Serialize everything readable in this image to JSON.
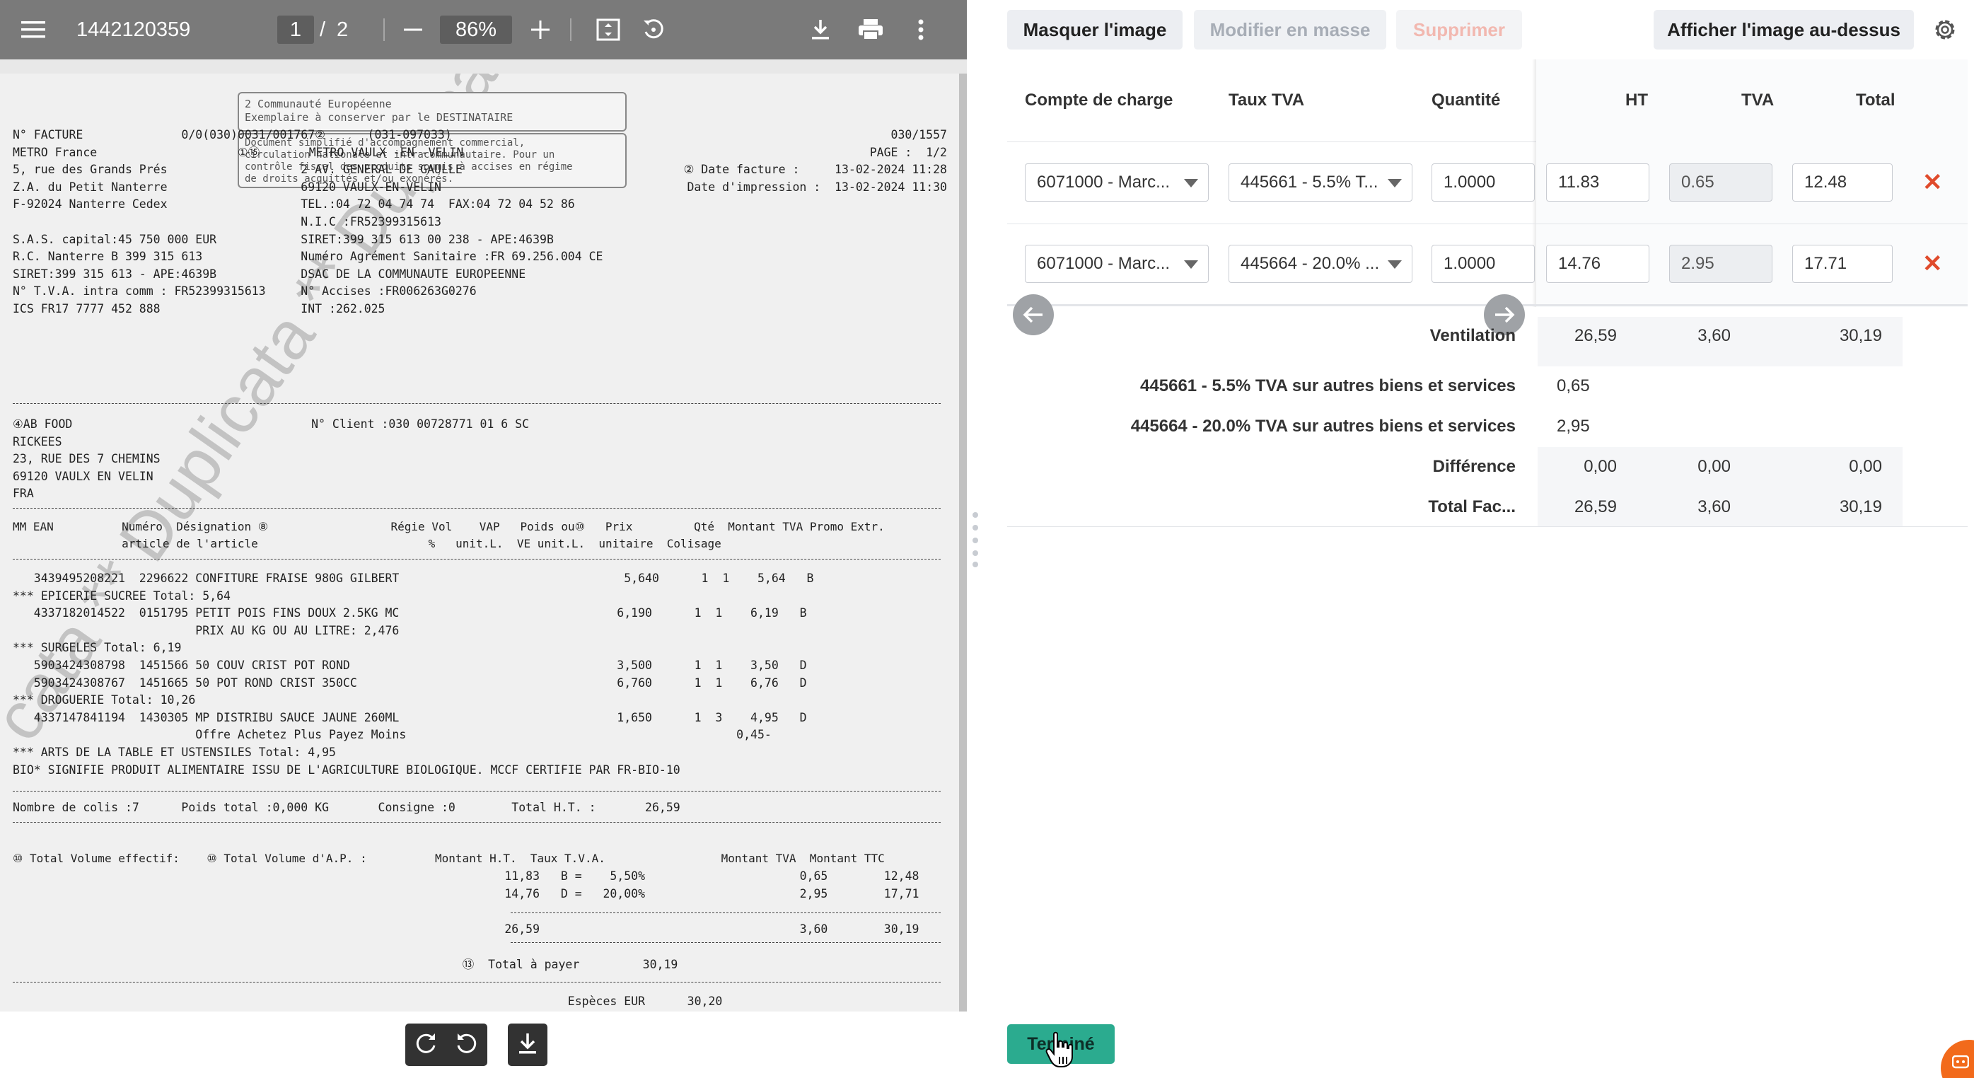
{
  "pdf_viewer": {
    "file_name": "1442120359",
    "page_current": "1",
    "page_separator": "/",
    "page_total": "2",
    "zoom": "86%",
    "icons": [
      "menu-icon",
      "zoom-out-icon",
      "zoom-in-icon",
      "fit-page-icon",
      "rotate-icon",
      "download-icon",
      "print-icon",
      "more-vert-icon"
    ]
  },
  "invoice": {
    "notice": [
      "2 Communauté Européenne",
      "Exemplaire à conserver par le DESTINATAIRE"
    ],
    "notice2": [
      "Document simplifié d'accompagnement commercial,",
      "circulation nationale et intracommunautaire. Pour un",
      "contrôle fiscal des produits soumis à accises en régime",
      "de droits acquittés et/ou exonérés."
    ],
    "header_lines": [
      {
        "l": "N° FACTURE              0/0(030)0031/001767②      (031-097033)",
        "r": "030/1557"
      },
      {
        "l": "METRO France                    ①⑮       METRO VAULX -EN -VELIN",
        "r": "PAGE :  1/2"
      },
      {
        "l": "5, rue des Grands Prés                   2 AV. GENERAL DE GAULLE",
        "r": "② Date facture :     13-02-2024 11:28"
      },
      {
        "l": "Z.A. du Petit Nanterre                   69120 VAULX-EN-VELIN",
        "r": "Date d'impression :  13-02-2024 11:30"
      },
      {
        "l": "F-92024 Nanterre Cedex                   TEL.:04 72 04 74 74  FAX:04 72 04 52 86",
        "r": ""
      },
      {
        "l": "                                         N.I.C :FR52399315613",
        "r": ""
      },
      {
        "l": "S.A.S. capital:45 750 000 EUR            SIRET:399 315 613 00 238 - APE:4639B",
        "r": ""
      },
      {
        "l": "R.C. Nanterre B 399 315 613              Numéro Agrément Sanitaire :FR 69.256.004 CE",
        "r": ""
      },
      {
        "l": "SIRET:399 315 613 - APE:4639B            DSAC DE LA COMMUNAUTE EUROPEENNE",
        "r": ""
      },
      {
        "l": "N° T.V.A. intra comm : FR52399315613     N° Accises :FR006263G0276",
        "r": ""
      },
      {
        "l": "ICS FR17 7777 452 888                    INT :262.025",
        "r": ""
      }
    ],
    "client_lines": [
      "④AB FOOD                                  N° Client :030 00728771 01 6 SC",
      "RICKEES",
      "23, RUE DES 7 CHEMINS",
      "69120 VAULX EN VELIN",
      "FRA"
    ],
    "col_header1": "MM EAN          Numéro  Désignation ⑧                  Régie Vol    VAP   Poids ou⑩   Prix         Qté  Montant TVA Promo Extr.",
    "col_header2": "                article de l'article                         %   unit.L.  VE unit.L.  unitaire  Colisage",
    "item_lines": [
      "   3439495208221  2296622 CONFITURE FRAISE 980G GILBERT                                5,640      1  1    5,64   B",
      "*** EPICERIE SUCREE Total: 5,64",
      "   4337182014522  0151795 PETIT POIS FINS DOUX 2.5KG MC                               6,190      1  1    6,19   B",
      "                          PRIX AU KG OU AU LITRE: 2,476",
      "*** SURGELES Total: 6,19",
      "   5903424308798  1451566 50 COUV CRIST POT ROND                                      3,500      1  1    3,50   D",
      "   5903424308767  1451665 50 POT ROND CRIST 350CC                                     6,760      1  1    6,76   D",
      "*** DROGUERIE Total: 10,26",
      "   4337147841194  1430305 MP DISTRIBU SAUCE JAUNE 260ML                               1,650      1  3    4,95   D",
      "                          Offre Achetez Plus Payez Moins                                               0,45-",
      "*** ARTS DE LA TABLE ET USTENSILES Total: 4,95",
      "BIO* SIGNIFIE PRODUIT ALIMENTAIRE ISSU DE L'AGRICULTURE BIOLOGIQUE. MCCF CERTIFIE PAR FR-BIO-10"
    ],
    "totals_line": "Nombre de colis :7      Poids total :0,000 KG       Consigne :0        Total H.T. :       26,59",
    "vat_header": "⑩ Total Volume effectif:    ⑩ Total Volume d'A.P. :          Montant H.T.  Taux T.V.A.                 Montant TVA  Montant TTC",
    "vat_lines": [
      "                                                                      11,83   B =    5,50%                      0,65        12,48",
      "                                                                      14,76   D =   20,00%                      2,95        17,71"
    ],
    "vat_total": "                                                                      26,59                                     3,60        30,19",
    "to_pay": "                                                                ⑬  Total à payer         30,19",
    "especes": "                                                                               Espèces EUR      30,20",
    "watermark": "cata ** Duplicata ** Duplicata **"
  },
  "toolbar": {
    "hide_image": "Masquer l'image",
    "bulk_edit": "Modifier en masse",
    "delete": "Supprimer",
    "show_image_above": "Afficher l'image au-dessus"
  },
  "table": {
    "headers": {
      "account": "Compte de charge",
      "vat_rate": "Taux TVA",
      "quantity": "Quantité",
      "ht": "HT",
      "tva": "TVA",
      "total": "Total"
    },
    "rows": [
      {
        "account": "6071000 - Marc...",
        "vat_rate": "445661 - 5.5% T...",
        "quantity": "1.0000",
        "ht": "11.83",
        "tva": "0.65",
        "total": "12.48"
      },
      {
        "account": "6071000 - Marc...",
        "vat_rate": "445664 - 20.0% ...",
        "quantity": "1.0000",
        "ht": "14.76",
        "tva": "2.95",
        "total": "17.71"
      }
    ],
    "delete_glyph": "✕"
  },
  "summary": {
    "ventilation": {
      "label": "Ventilation",
      "ht": "26,59",
      "tva": "3,60",
      "total": "30,19"
    },
    "vat_lines": [
      {
        "label": "445661 - 5.5% TVA sur autres biens et services",
        "value": "0,65"
      },
      {
        "label": "445664 - 20.0% TVA sur autres biens et services",
        "value": "2,95"
      }
    ],
    "difference": {
      "label": "Différence",
      "ht": "0,00",
      "tva": "0,00",
      "total": "0,00"
    },
    "total_invoice": {
      "label": "Total Fac...",
      "ht": "26,59",
      "tva": "3,60",
      "total": "30,19"
    }
  },
  "footer": {
    "done": "Terminé"
  },
  "colors": {
    "done_button": "#2bab8f",
    "delete_icon": "#e04b2c",
    "chat_bubble": "#f26a1b",
    "pdf_toolbar": "#7a7a7a"
  }
}
